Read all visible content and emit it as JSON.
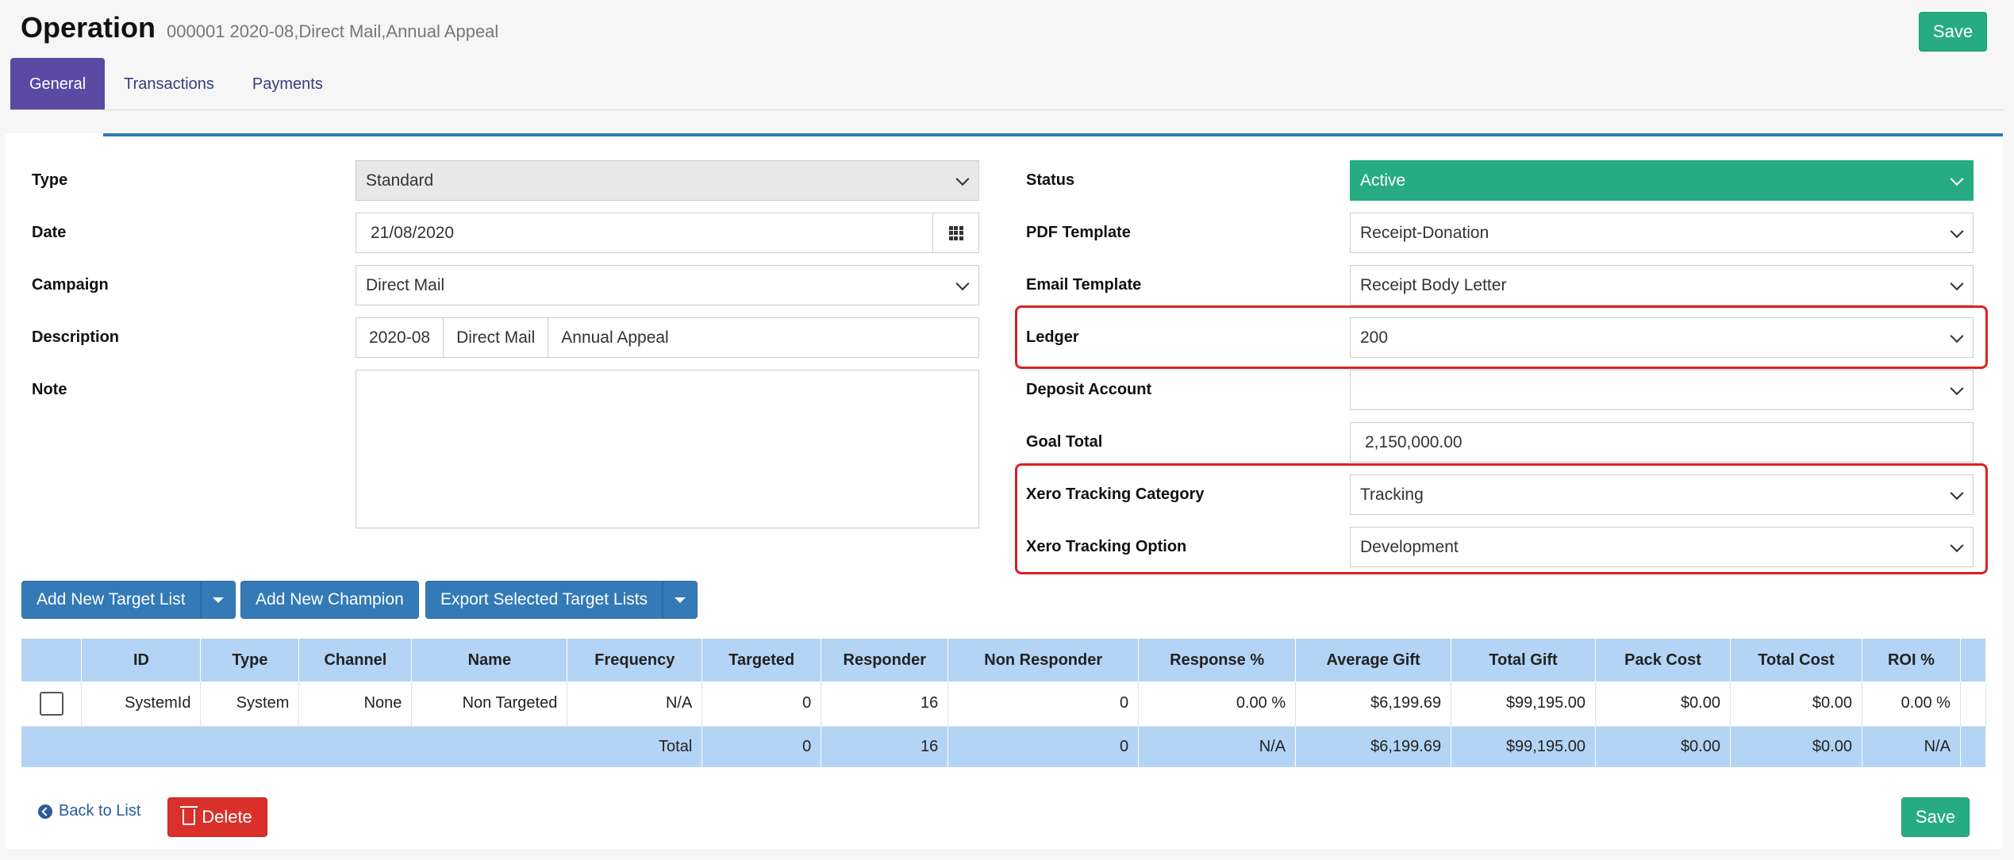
{
  "header": {
    "title": "Operation",
    "subtitle": "000001 2020-08,Direct Mail,Annual Appeal",
    "save_label": "Save"
  },
  "tabs": [
    {
      "label": "General",
      "active": true
    },
    {
      "label": "Transactions",
      "active": false
    },
    {
      "label": "Payments",
      "active": false
    }
  ],
  "form_left": {
    "type": {
      "label": "Type",
      "value": "Standard"
    },
    "date": {
      "label": "Date",
      "value": "21/08/2020",
      "icon": "calendar-grid-icon"
    },
    "campaign": {
      "label": "Campaign",
      "value": "Direct Mail"
    },
    "description": {
      "label": "Description",
      "parts": [
        "2020-08",
        "Direct Mail",
        "Annual Appeal"
      ]
    },
    "note": {
      "label": "Note",
      "value": ""
    }
  },
  "form_right": {
    "status": {
      "label": "Status",
      "value": "Active"
    },
    "pdf_template": {
      "label": "PDF Template",
      "value": "Receipt-Donation"
    },
    "email_template": {
      "label": "Email Template",
      "value": "Receipt Body Letter"
    },
    "ledger": {
      "label": "Ledger",
      "value": "200"
    },
    "deposit_account": {
      "label": "Deposit Account",
      "value": ""
    },
    "goal_total": {
      "label": "Goal Total",
      "value": "2,150,000.00"
    },
    "xero_tracking_category": {
      "label": "Xero Tracking Category",
      "value": "Tracking"
    },
    "xero_tracking_option": {
      "label": "Xero Tracking Option",
      "value": "Development"
    }
  },
  "actions": {
    "add_target_list": "Add New Target List",
    "add_champion": "Add New Champion",
    "export_target_lists": "Export Selected Target Lists"
  },
  "table": {
    "headers": [
      "",
      "ID",
      "Type",
      "Channel",
      "Name",
      "Frequency",
      "Targeted",
      "Responder",
      "Non Responder",
      "Response %",
      "Average Gift",
      "Total Gift",
      "Pack Cost",
      "Total Cost",
      "ROI %",
      ""
    ],
    "rows": [
      [
        "",
        "SystemId",
        "System",
        "None",
        "Non Targeted",
        "N/A",
        "0",
        "16",
        "0",
        "0.00 %",
        "$6,199.69",
        "$99,195.00",
        "$0.00",
        "$0.00",
        "0.00 %",
        ""
      ]
    ],
    "total": {
      "label": "Total",
      "values": [
        "0",
        "16",
        "0",
        "N/A",
        "$6,199.69",
        "$99,195.00",
        "$0.00",
        "$0.00",
        "N/A"
      ]
    }
  },
  "footer": {
    "back_label": "Back to List",
    "delete_label": "Delete",
    "save_label": "Save"
  },
  "colors": {
    "primary_tab": "#5a4aa3",
    "success": "#27ab83",
    "primary_button": "#337ab7",
    "danger": "#d9302b",
    "table_header": "#b3d4f5",
    "highlight_box": "#e02020"
  }
}
